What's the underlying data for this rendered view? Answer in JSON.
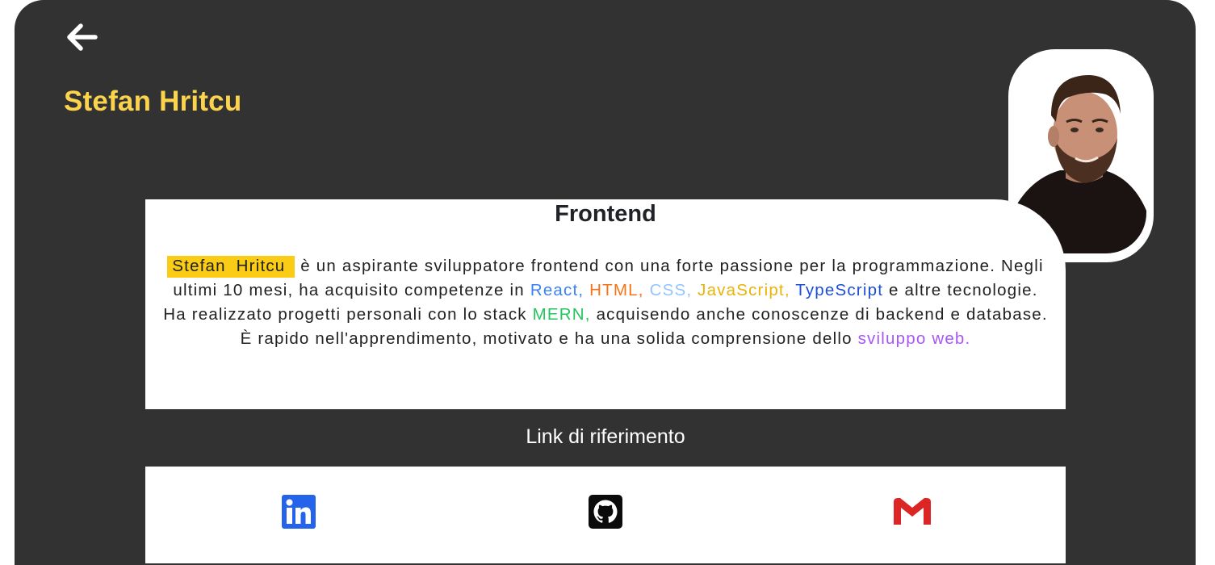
{
  "profile": {
    "name": "Stefan Hritcu",
    "photo_alt": "profile photo"
  },
  "card": {
    "title": "Frontend",
    "bio": {
      "highlight_name": "Stefan  Hritcu",
      "t1": " è un aspirante sviluppatore frontend con una forte passione per la programmazione. Negli ultimi 10 mesi, ha acquisito competenze in ",
      "react": "React,",
      "html": " HTML,",
      "css": " CSS,",
      "js": " JavaScript,",
      "ts": " TypeScript",
      "t2": " e altre tecnologie. Ha realizzato progetti personali con lo stack ",
      "mern": "MERN,",
      "t3": " acquisendo anche conoscenze di backend e database. È rapido nell'apprendimento, motivato e ha una solida comprensione dello ",
      "web": "sviluppo web."
    }
  },
  "links": {
    "title": "Link di riferimento",
    "items": [
      {
        "icon": "linkedin-icon"
      },
      {
        "icon": "github-icon"
      },
      {
        "icon": "gmail-icon"
      }
    ]
  },
  "colors": {
    "background": "#323232",
    "name_accent": "#fcd34d",
    "highlight": "#facc15",
    "react": "#3b82f6",
    "html": "#f97316",
    "css": "#93c5fd",
    "javascript": "#eab308",
    "typescript": "#1d4ed8",
    "mern": "#22c55e",
    "web": "#a855f7"
  }
}
